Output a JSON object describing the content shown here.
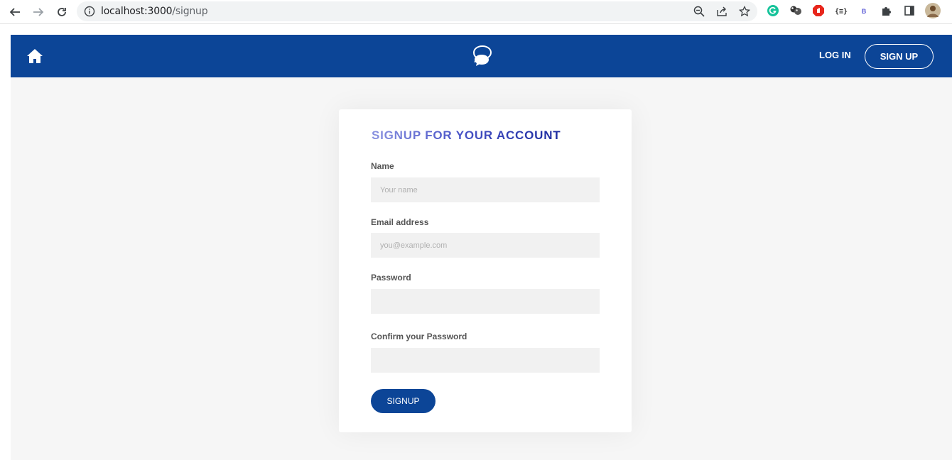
{
  "browser": {
    "url_host": "localhost:3000",
    "url_path": "/signup"
  },
  "navbar": {
    "login_label": "LOG IN",
    "signup_label": "SIGN UP",
    "brand_color": "#0c4597"
  },
  "form": {
    "title": "SIGNUP FOR YOUR ACCOUNT",
    "name_label": "Name",
    "name_placeholder": "Your name",
    "email_label": "Email address",
    "email_placeholder": "you@example.com",
    "password_label": "Password",
    "password_placeholder": "",
    "confirm_label": "Confirm your Password",
    "confirm_placeholder": "",
    "submit_label": "SIGNUP"
  }
}
